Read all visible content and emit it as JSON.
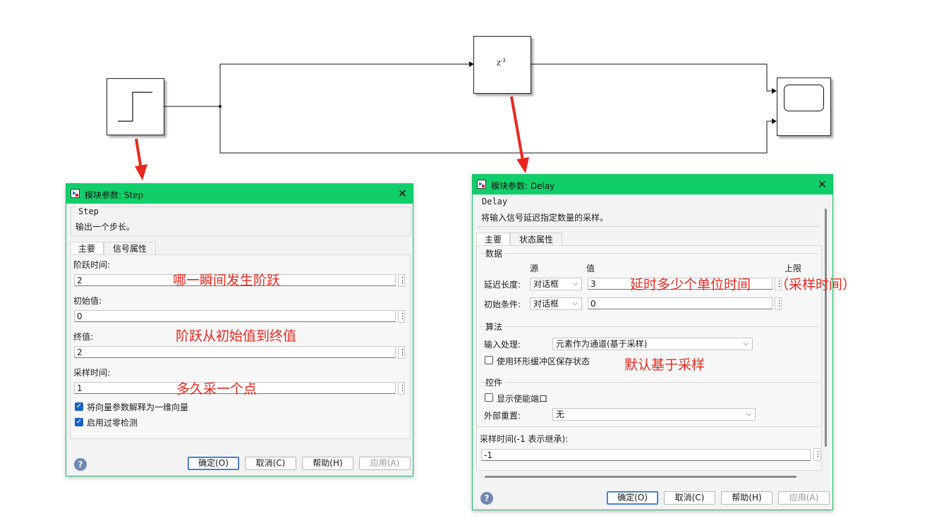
{
  "diagram": {
    "delay_block": {
      "label": "z",
      "exponent": "-3"
    }
  },
  "step_dialog": {
    "title": "模块参数: Step",
    "block_name": "Step",
    "description": "输出一个步长。",
    "tabs": [
      "主要",
      "信号属性"
    ],
    "fields": [
      {
        "label": "阶跃时间:",
        "value": "2"
      },
      {
        "label": "初始值:",
        "value": "0"
      },
      {
        "label": "终值:",
        "value": "2"
      },
      {
        "label": "采样时间:",
        "value": "1"
      }
    ],
    "checkboxes": [
      {
        "label": "将向量参数解释为一维向量",
        "checked": true
      },
      {
        "label": "启用过零检测",
        "checked": true
      }
    ],
    "buttons": {
      "ok": "确定(O)",
      "cancel": "取消(C)",
      "help": "帮助(H)",
      "apply": "应用(A)"
    }
  },
  "delay_dialog": {
    "title": "模块参数: Delay",
    "block_name": "Delay",
    "description": "将输入信号延迟指定数量的采样。",
    "tabs": [
      "主要",
      "状态属性"
    ],
    "data_section": {
      "title": "数据",
      "col_source": "源",
      "col_value": "值",
      "col_upper": "上限",
      "rows": [
        {
          "label": "延迟长度:",
          "source": "对话框",
          "value": "3"
        },
        {
          "label": "初始条件:",
          "source": "对话框",
          "value": "0"
        }
      ]
    },
    "algorithm_section": {
      "title": "算法",
      "input_processing_label": "输入处理:",
      "input_processing_value": "元素作为通道(基于采样)",
      "circular_buffer_label": "使用环形缓冲区保存状态",
      "circular_buffer_checked": false
    },
    "control_section": {
      "title": "控件",
      "enable_port_label": "显示使能端口",
      "enable_port_checked": false,
      "external_reset_label": "外部重置:",
      "external_reset_value": "无"
    },
    "sample_time_label": "采样时间(-1 表示继承):",
    "sample_time_value": "-1",
    "buttons": {
      "ok": "确定(O)",
      "cancel": "取消(C)",
      "help": "帮助(H)",
      "apply": "应用(A)"
    }
  },
  "annotations": {
    "step_time": "哪一瞬间发生阶跃",
    "initial_to_final": "阶跃从初始值到终值",
    "sample_time": "多久采一个点",
    "delay_length": "延时多少个单位时间",
    "delay_length_note": "（采样时间）",
    "sample_based": "默认基于采样"
  },
  "colors": {
    "titlebar": "#10cf6b",
    "annotation": "#e8281e",
    "checkbox": "#1a62c4"
  }
}
